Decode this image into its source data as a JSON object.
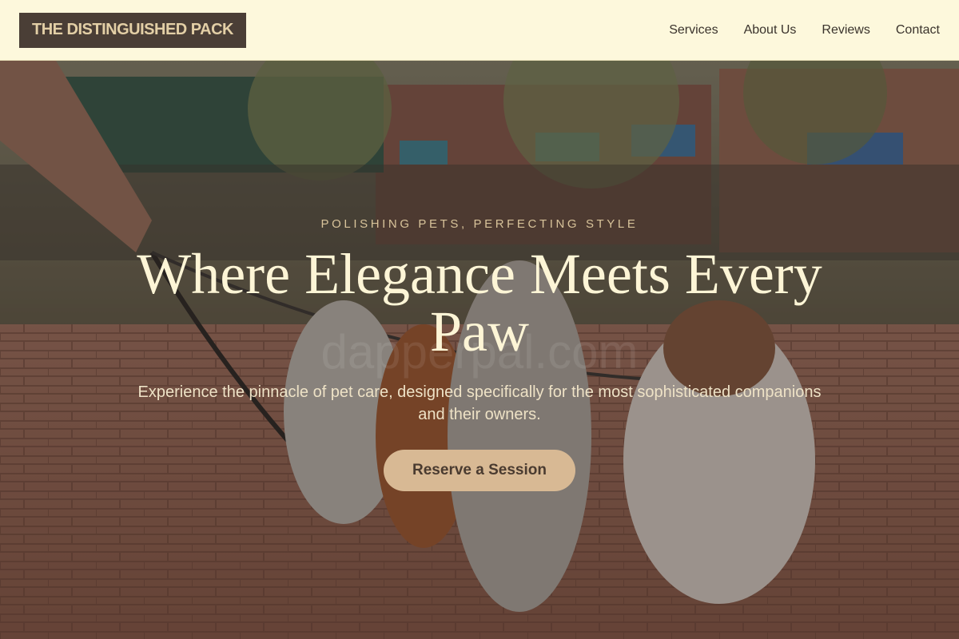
{
  "header": {
    "logo": "THE DISTINGUISHED PACK",
    "nav": [
      "Services",
      "About Us",
      "Reviews",
      "Contact"
    ]
  },
  "hero": {
    "tagline": "POLISHING PETS, PERFECTING STYLE",
    "headline": "Where Elegance Meets Every Paw",
    "subtext": "Experience the pinnacle of pet care, designed specifically for the most sophisticated companions and their owners.",
    "cta": "Reserve a Session",
    "watermark": "dapperpal.com",
    "photo_description": "dogs on leashes sitting on a brick plaza"
  },
  "colors": {
    "header_bg": "#fdf8dc",
    "logo_bg": "#4a3e36",
    "logo_text": "#e3cfa6",
    "accent": "#d8b994",
    "headline": "#fdf5d6"
  }
}
